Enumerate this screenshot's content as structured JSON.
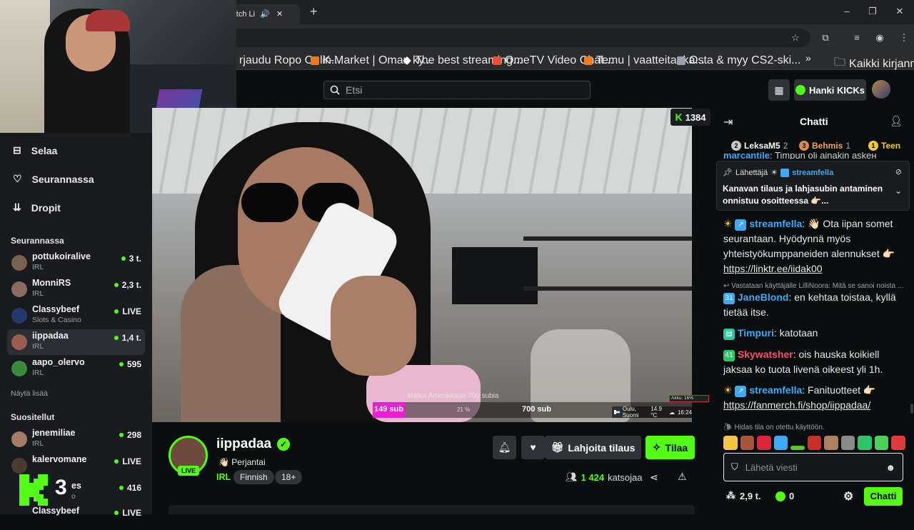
{
  "browser": {
    "tab_title": "- Watch Li",
    "tab_audio_icon": "speaker-icon",
    "new_tab": "+",
    "window_controls": [
      "–",
      "❐",
      "✕"
    ],
    "bookmarks": [
      {
        "label": "rjaudu Ropo Onlin...",
        "color": "#8a5cf6"
      },
      {
        "label": "K-Market | Oman ky...",
        "color": "#f07a18"
      },
      {
        "label": "The best streaming...",
        "color": "#ffffff"
      },
      {
        "label": "OmeTV Video Chat...",
        "color": "#f24e3b"
      },
      {
        "label": "Temu | vaatteita, ka...",
        "color": "#f47c20"
      },
      {
        "label": "Osta & myy CS2-ski...",
        "color": "#9aa2b0"
      }
    ],
    "bookmarks_more": "»",
    "all_bookmarks": "Kaikki kirjanmerkit"
  },
  "header": {
    "search_placeholder": "Etsi",
    "get_kicks": "Hanki KICKs"
  },
  "sidebar": {
    "nav": [
      {
        "label": "Selaa",
        "icon": "browse-icon"
      },
      {
        "label": "Seurannassa",
        "icon": "heart-icon"
      },
      {
        "label": "Dropit",
        "icon": "drops-icon"
      }
    ],
    "following_title": "Seurannassa",
    "following": [
      {
        "name": "pottukoiralive",
        "category": "IRL",
        "viewers": "3 t.",
        "avatar": "#7a6253"
      },
      {
        "name": "MonniRS",
        "category": "IRL",
        "viewers": "2,3 t.",
        "avatar": "#8d6b61"
      },
      {
        "name": "Classybeef",
        "category": "Slots & Casino",
        "viewers": "LIVE",
        "avatar": "#233a6b"
      },
      {
        "name": "iippadaa",
        "category": "IRL",
        "viewers": "1,4 t.",
        "avatar": "#9a5d52"
      },
      {
        "name": "aapo_olervo",
        "category": "IRL",
        "viewers": "595",
        "avatar": "#3a8a3a"
      }
    ],
    "show_more": "Näytä lisää",
    "recommended_title": "Suositellut",
    "recommended": [
      {
        "name": "jenemiliae",
        "category": "IRL",
        "viewers": "298",
        "avatar": "#a77a63"
      },
      {
        "name": "kalervomane",
        "category": "",
        "viewers": "LIVE",
        "avatar": "#4a3a30"
      },
      {
        "name": "es",
        "category": "o",
        "viewers": "416",
        "avatar": "#555"
      },
      {
        "name": "Classybeef",
        "category": "",
        "viewers": "LIVE",
        "avatar": "#233a6b"
      }
    ],
    "overlay_number": "3"
  },
  "video": {
    "viewer_count": "1384",
    "goal_text": "Matka Amerikkaan 700 subia",
    "sub_current": "149 sub",
    "sub_percent": "21 %",
    "sub_goal": "700 sub",
    "sub_progress": 0.21,
    "battery": "Akku: 16%",
    "location": "Oulu, Suomi",
    "temperature": "14.9 °C",
    "time": "16:24"
  },
  "channel": {
    "name": "iippadaa",
    "live_badge": "LIVE",
    "title": "👋🏻 Perjantai",
    "category": "IRL",
    "tags": [
      "Finnish",
      "18+"
    ],
    "gift_button": "Lahjoita tilaus",
    "subscribe_button": "Tilaa",
    "watchers_count": "1 424",
    "watchers_label": "katsojaa"
  },
  "chat": {
    "title": "Chatti",
    "gifters": [
      {
        "rank": "2",
        "name": "LeksaM5",
        "count": "2",
        "color": "#ffffff",
        "badge": "#c8c8c8"
      },
      {
        "rank": "3",
        "name": "Behmis",
        "count": "1",
        "color": "#f0a05a",
        "badge": "#d98b4a"
      },
      {
        "rank": "1",
        "name": "Teen",
        "count": "",
        "color": "#f4c542",
        "badge": "#f4c542"
      }
    ],
    "pinned_by_label": "Lähettäjä",
    "pinned_by_user": "streamfella",
    "pinned_text": "Kanavan tilaus ja lahjasubin antaminen onnistuu osoitteessa 👉🏻...",
    "hidden_top_user": "marcantile",
    "hidden_top_text": "Timpun oli ainakin askeн",
    "messages": [
      {
        "user": "streamfella",
        "color": "#3fa9f5",
        "text": ": 👋🏻 Ota iipan somet seurantaan. Hyödynnä myös yhteistyökumppaneiden alennukset 👉🏻 ",
        "link": "https://linktr.ee/iidak00",
        "badges": [
          "☀️",
          "bot"
        ]
      },
      {
        "reply": "Vastataan käyttäjälle LilliNoora: Mitä se sanoi noista ...",
        "user": "JaneBlond",
        "color": "#3fa9f5",
        "text": ": en kehtaa toistaa, kyllä tietää itse.",
        "badge_num": "31",
        "badge_color": "#3fa9f5"
      },
      {
        "user": "Timpuri",
        "color": "#3fa9f5",
        "text": ": katotaan",
        "badge_num": "",
        "badge_color": "#2ec4a0"
      },
      {
        "user": "Skywatsher",
        "color": "#ff4f6e",
        "text": ": ois hauska koikiell jaksaa ko tuota livenä oikeest yli 1h.",
        "badge_num": "41",
        "badge_color": "#2ec46a"
      },
      {
        "user": "streamfella",
        "color": "#3fa9f5",
        "text": ": Fanituotteet 👉🏻 ",
        "link": "https://fanmerch.fi/shop/iippadaa/",
        "badges": [
          "☀️",
          "bot"
        ]
      }
    ],
    "slow_mode": "Hidas tila on otettu käyttöön.",
    "input_placeholder": "Lähetä viesti",
    "points": "2,9 t.",
    "kicks": "0",
    "chat_button": "Chatti"
  }
}
